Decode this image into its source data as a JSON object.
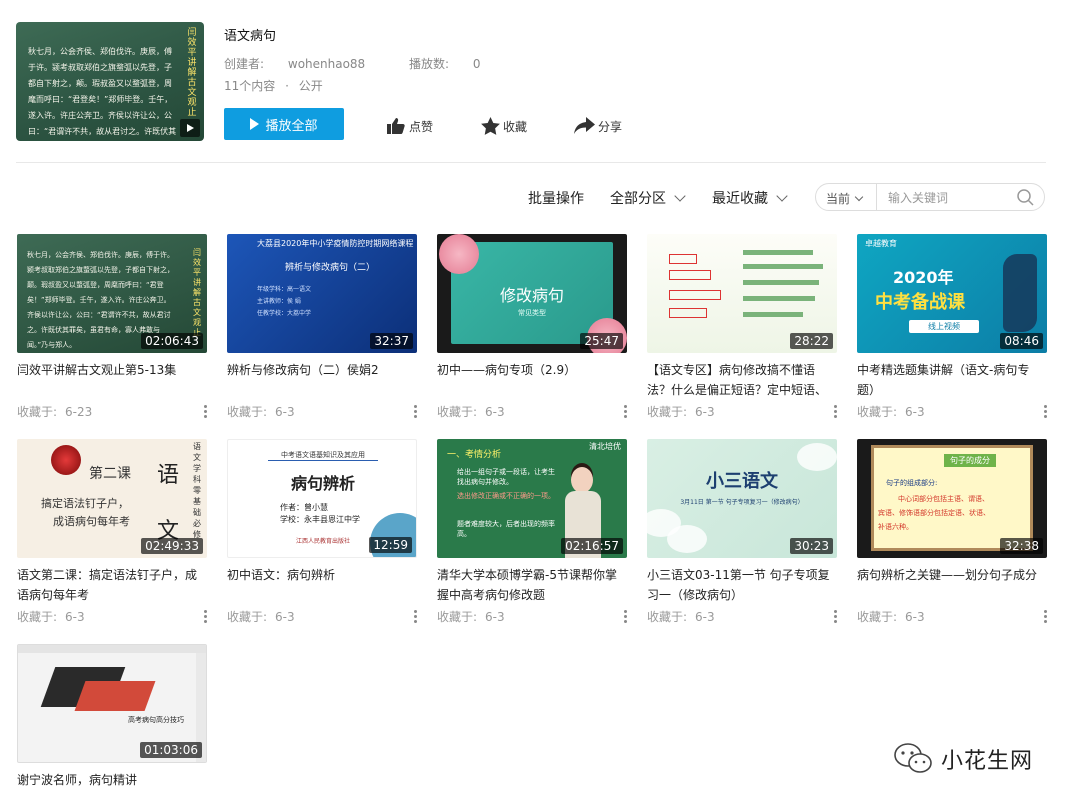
{
  "playlist": {
    "title": "语文病句",
    "creator_label": "创建者:",
    "creator": "wohenhao88",
    "plays_label": "播放数:",
    "plays": "0",
    "count": "11个内容",
    "sep": "·",
    "visibility": "公开",
    "play_all": "播放全部",
    "like": "点赞",
    "favorite": "收藏",
    "share": "分享",
    "cover_duration": ""
  },
  "toolbar": {
    "batch": "批量操作",
    "section": "全部分区",
    "sort": "最近收藏",
    "scope": "当前",
    "search_placeholder": "输入关键词"
  },
  "fav_label": "收藏于:",
  "videos": [
    {
      "title": "闫效平讲解古文观止第5-13集",
      "duration": "02:06:43",
      "date": "6-23"
    },
    {
      "title": "辨析与修改病句（二）侯娟2",
      "duration": "32:37",
      "date": "6-3"
    },
    {
      "title": "初中——病句专项（2.9）",
      "duration": "25:47",
      "date": "6-3"
    },
    {
      "title": "【语文专区】病句修改搞不懂语法？什么是偏正短语？定中短语、",
      "duration": "28:22",
      "date": "6-3"
    },
    {
      "title": "中考精选题集讲解（语文-病句专题）",
      "duration": "08:46",
      "date": "6-3"
    },
    {
      "title": "语文第二课：搞定语法钉子户，成语病句每年考",
      "duration": "02:49:33",
      "date": "6-3"
    },
    {
      "title": "初中语文：病句辨析",
      "duration": "12:59",
      "date": "6-3"
    },
    {
      "title": "清华大学本硕博学霸-5节课帮你掌握中高考病句修改题",
      "duration": "02:16:57",
      "date": "6-3"
    },
    {
      "title": "小三语文03-11第一节 句子专项复习一（修改病句）",
      "duration": "30:23",
      "date": "6-3"
    },
    {
      "title": "病句辨析之关键——划分句子成分",
      "duration": "32:38",
      "date": "6-3"
    },
    {
      "title": "谢宁波名师，病句精讲",
      "duration": "01:03:06",
      "date": ""
    }
  ],
  "thumbs": {
    "guwen_text": "秋七月，公会齐侯、郑伯伐许。庚辰，傅于许。颍考叔取郑伯之旗蝥弧以先登，子都自下射之，颠。瑕叔盈又以蝥弧登，周麾而呼曰：“君登矣！”郑师毕登。壬午，遂入许。许庄公奔卫。齐侯以许让公，公曰：“君谓许不共，故从君讨之。许既伏其罪矣，虽君有命，寡人弗敢与闻。”乃与郑人。",
    "guwen_vert": "闫效平讲解古文观止",
    "blue_top": "大荔县2020年中小学疫情防控时期网络课程",
    "blue_title": "辨析与修改病句（二）",
    "blue_info": "年级学科：高一语文\n主讲教师：侯 娟\n任教学校：大荔中学",
    "floral_big": "修改病句",
    "floral_small": "常见类型",
    "exam_logo": "卓越教育",
    "exam_year": "2020年",
    "exam_big": "中考备战课",
    "exam_bar": "线上视频",
    "paper_ke": "第二课",
    "paper_yu": "语",
    "paper_wen": "文",
    "paper_sub1": "搞定语法钉子户，",
    "paper_sub2": "成语病句每年考",
    "paper_vert": "语文学科零基础必修",
    "white_hdr": "中考语文语基知识及其应用",
    "white_big": "病句辨析",
    "white_l1": "作者：曾小慧",
    "white_l2": "学校：永丰县恩江中学",
    "white_seal": "江西人民教育出版社",
    "class_h": "一、考情分析",
    "class_logo": "清北培优",
    "class_l1": "给出一组句子或一段话，让考生找出病句并修改。",
    "class_l2": "选出修改正确或不正确的一项。",
    "class_l3": "题者难度较大，后者出现的频率高。",
    "lotus_big": "小三语文",
    "lotus_s": "3月11日 第一节 句子专项复习一（修改病句）",
    "board_tag": "句子的成分",
    "board_l1": "句子的组成部分:",
    "board_l2": "中心词部分包括主语、谓语、",
    "board_l3": "宾语、修饰语部分包括定语、状语、",
    "board_l4": "补语六种。",
    "screen_txt": "高考病句高分技巧"
  },
  "watermark": "小花生网",
  "colors": {
    "accent": "#0f9de0"
  }
}
